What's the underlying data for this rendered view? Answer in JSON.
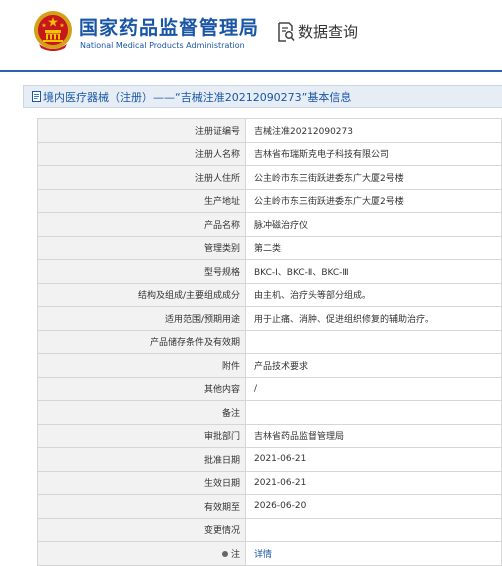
{
  "header": {
    "org_name_cn": "国家药品监督管理局",
    "org_name_en": "National Medical Products Administration",
    "query_label": "数据查询"
  },
  "title_bar": {
    "text": "境内医疗器械（注册）——“吉械注准20212090273”基本信息"
  },
  "rows": [
    {
      "label": "注册证编号",
      "value": "吉械注准20212090273"
    },
    {
      "label": "注册人名称",
      "value": "吉林省布瑞斯克电子科技有限公司"
    },
    {
      "label": "注册人住所",
      "value": "公主岭市东三街跃进委东广大厦2号楼"
    },
    {
      "label": "生产地址",
      "value": "公主岭市东三街跃进委东广大厦2号楼"
    },
    {
      "label": "产品名称",
      "value": "脉冲磁治疗仪"
    },
    {
      "label": "管理类别",
      "value": "第二类"
    },
    {
      "label": "型号规格",
      "value": "BKC-Ⅰ、BKC-Ⅱ、BKC-Ⅲ"
    },
    {
      "label": "结构及组成/主要组成成分",
      "value": "由主机、治疗头等部分组成。"
    },
    {
      "label": "适用范围/预期用途",
      "value": "用于止痛、消肿、促进组织修复的辅助治疗。"
    },
    {
      "label": "产品储存条件及有效期",
      "value": ""
    },
    {
      "label": "附件",
      "value": "产品技术要求"
    },
    {
      "label": "其他内容",
      "value": "/"
    },
    {
      "label": "备注",
      "value": ""
    },
    {
      "label": "审批部门",
      "value": "吉林省药品监督管理局"
    },
    {
      "label": "批准日期",
      "value": "2021-06-21"
    },
    {
      "label": "生效日期",
      "value": "2021-06-21"
    },
    {
      "label": "有效期至",
      "value": "2026-06-20"
    },
    {
      "label": "变更情况",
      "value": ""
    },
    {
      "label": "注",
      "value": "详情"
    }
  ]
}
